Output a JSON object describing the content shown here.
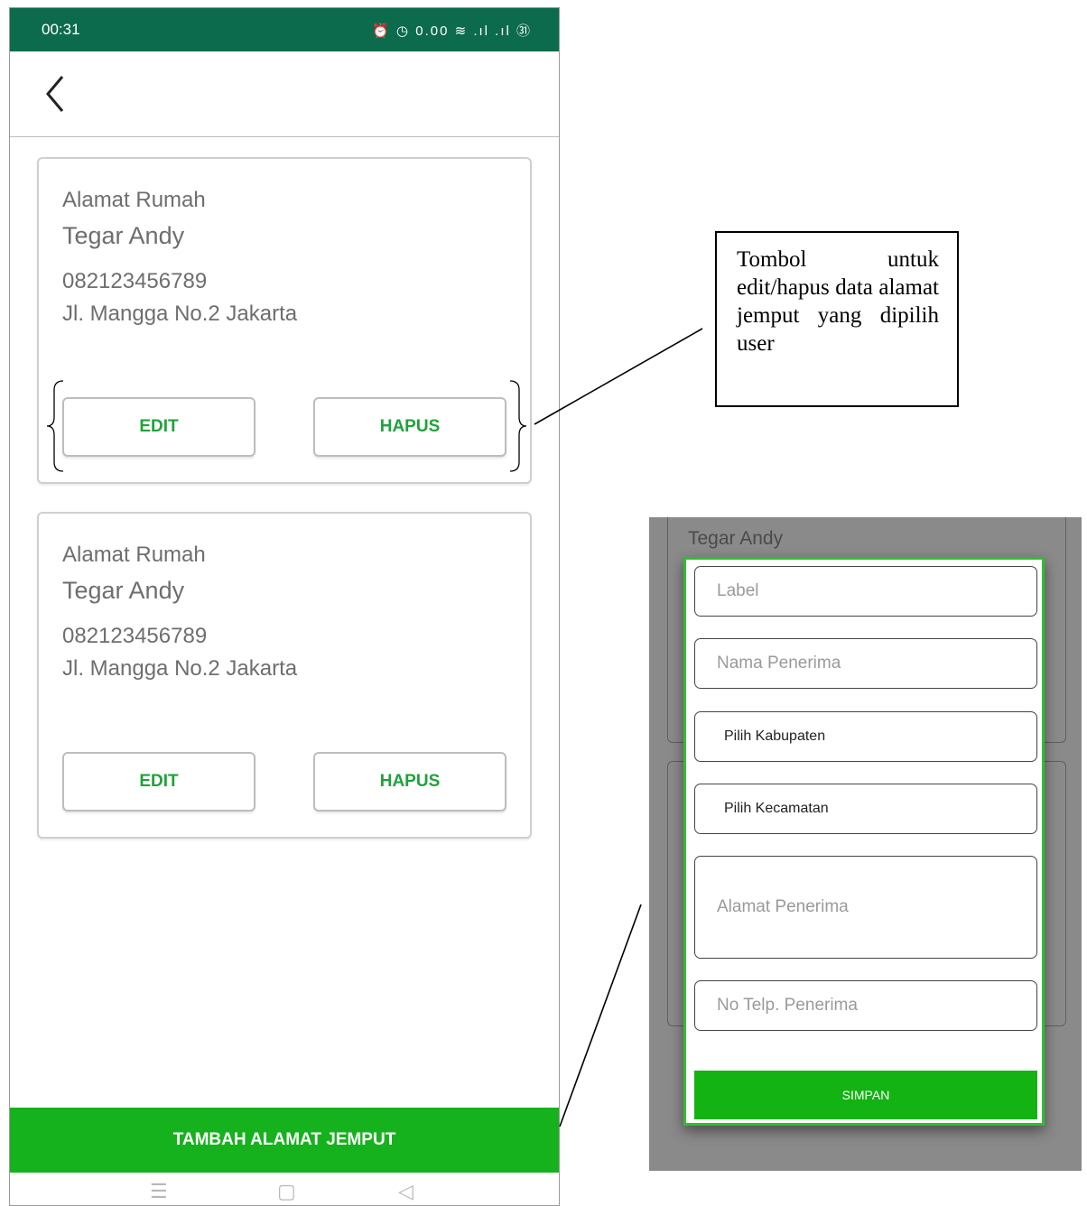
{
  "status_bar": {
    "time": "00:31",
    "icons": "⏰ ◷ 0.00 ≋ .ıl .ıl ㉛"
  },
  "cards": [
    {
      "label": "Alamat Rumah",
      "name": "Tegar Andy",
      "phone": "082123456789",
      "address": "Jl. Mangga No.2 Jakarta",
      "edit_label": "EDIT",
      "delete_label": "HAPUS"
    },
    {
      "label": "Alamat Rumah",
      "name": "Tegar Andy",
      "phone": "082123456789",
      "address": "Jl. Mangga No.2 Jakarta",
      "edit_label": "EDIT",
      "delete_label": "HAPUS"
    }
  ],
  "add_button_label": "TAMBAH ALAMAT JEMPUT",
  "callout_text": "Tombol untuk edit/hapus data alamat jemput yang dipilih user",
  "dialog": {
    "background_name": "Tegar Andy",
    "label_placeholder": "Label",
    "recipient_name_placeholder": "Nama Penerima",
    "regency_select": "Pilih Kabupaten",
    "district_select": "Pilih Kecamatan",
    "address_placeholder": "Alamat Penerima",
    "phone_placeholder": "No Telp. Penerima",
    "save_label": "SIMPAN"
  },
  "colors": {
    "status_bar": "#0d6b4d",
    "accent_green": "#16b21d",
    "button_text_green": "#1ea33a"
  },
  "icons": [
    "back-arrow-icon",
    "menu-icon",
    "home-icon",
    "back-triangle-icon"
  ]
}
